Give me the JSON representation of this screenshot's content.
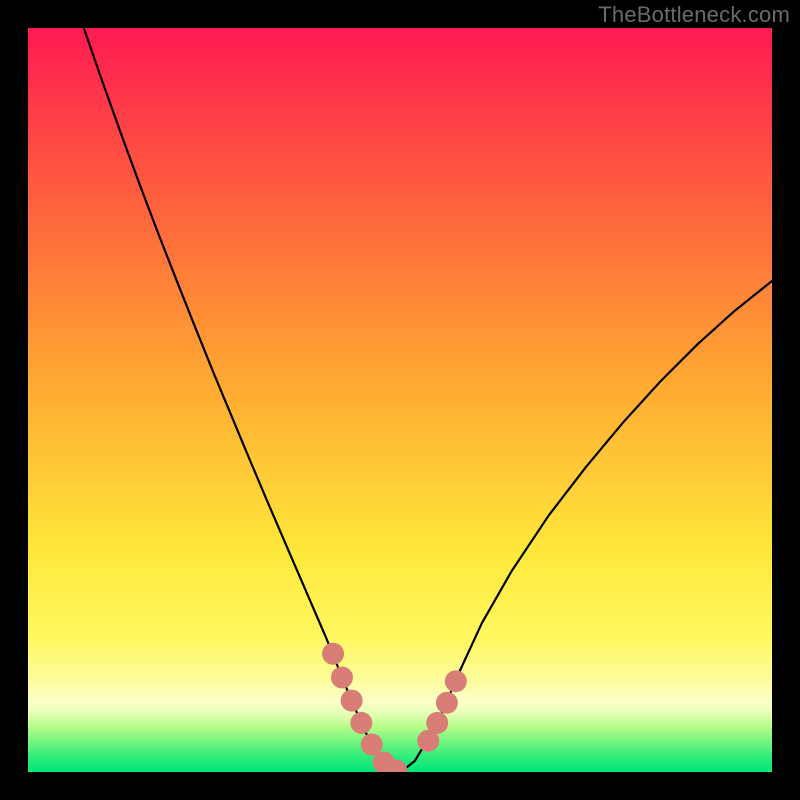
{
  "watermark": "TheBottleneck.com",
  "chart_data": {
    "type": "line",
    "title": "",
    "xlabel": "",
    "ylabel": "",
    "xlim": [
      0,
      100
    ],
    "ylim": [
      0,
      100
    ],
    "grid": false,
    "series": [
      {
        "name": "curve",
        "x": [
          7.5,
          10,
          12.5,
          15,
          17.5,
          20,
          22.5,
          25,
          27.5,
          30,
          32.5,
          35,
          37.5,
          40,
          41.5,
          43,
          44.5,
          46,
          47.5,
          49,
          50.5,
          52,
          55,
          58,
          61,
          65,
          70,
          75,
          80,
          85,
          90,
          95,
          100
        ],
        "y": [
          100,
          92.8,
          85.8,
          79,
          72.4,
          66,
          59.7,
          53.5,
          47.5,
          41.5,
          35.6,
          29.8,
          24.0,
          18.2,
          14.5,
          10.8,
          7.3,
          4.0,
          1.5,
          0.3,
          0.3,
          1.5,
          6.5,
          13.5,
          20,
          27,
          34.5,
          41,
          47,
          52.5,
          57.5,
          62,
          66
        ]
      }
    ],
    "markers": {
      "name": "salmon-dots",
      "color": "#d97d77",
      "points": [
        {
          "x": 41.0,
          "y": 15.9
        },
        {
          "x": 42.2,
          "y": 12.7
        },
        {
          "x": 43.5,
          "y": 9.6
        },
        {
          "x": 44.8,
          "y": 6.6
        },
        {
          "x": 46.2,
          "y": 3.7
        },
        {
          "x": 47.8,
          "y": 1.3
        },
        {
          "x": 49.5,
          "y": 0.2
        },
        {
          "x": 53.8,
          "y": 4.2
        },
        {
          "x": 55.0,
          "y": 6.6
        },
        {
          "x": 56.3,
          "y": 9.3
        },
        {
          "x": 57.5,
          "y": 12.2
        }
      ]
    },
    "background_gradient": {
      "top_color": "#ff1a52",
      "mid_color": "#ffe73a",
      "bottom_accent_1": "#fdfda0",
      "bottom_accent_2": "#b3fd87",
      "bottom_color": "#00e679"
    }
  }
}
